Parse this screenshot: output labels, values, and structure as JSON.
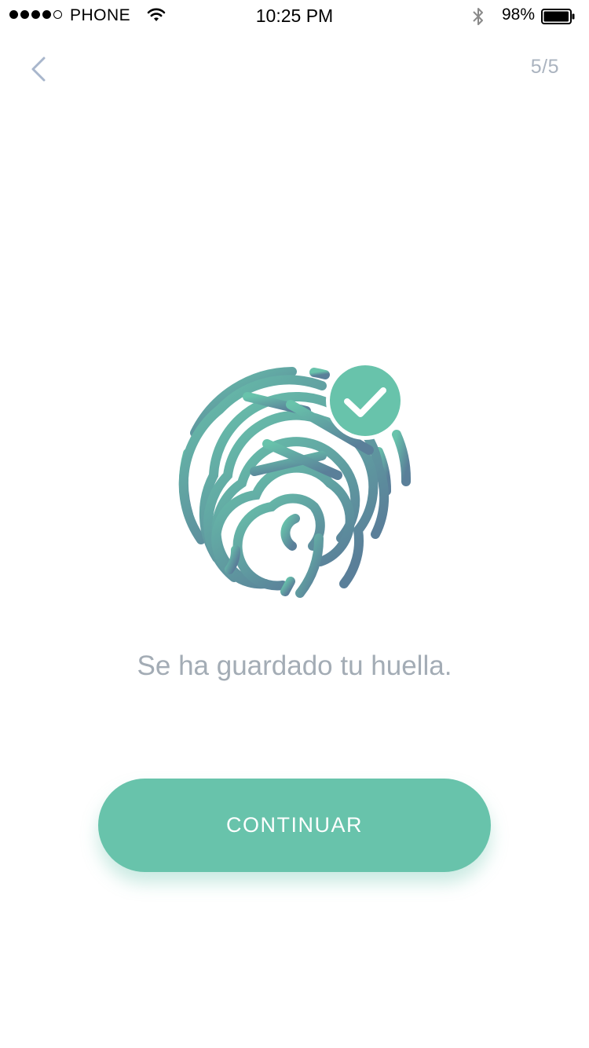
{
  "status_bar": {
    "carrier": "PHONE",
    "time": "10:25 PM",
    "battery_percent": "98%",
    "signal_bars_filled": 4,
    "signal_bars_total": 5
  },
  "nav": {
    "back_icon": "chevron-left-icon",
    "step_indicator": "5/5"
  },
  "illustration": {
    "icon": "fingerprint-icon",
    "badge_icon": "checkmark-icon",
    "gradient_start": "#68c3ab",
    "gradient_end": "#5a7f99"
  },
  "message": "Se ha guardado tu huella.",
  "continue_button": {
    "label": "CONTINUAR",
    "color": "#68c3ab"
  }
}
